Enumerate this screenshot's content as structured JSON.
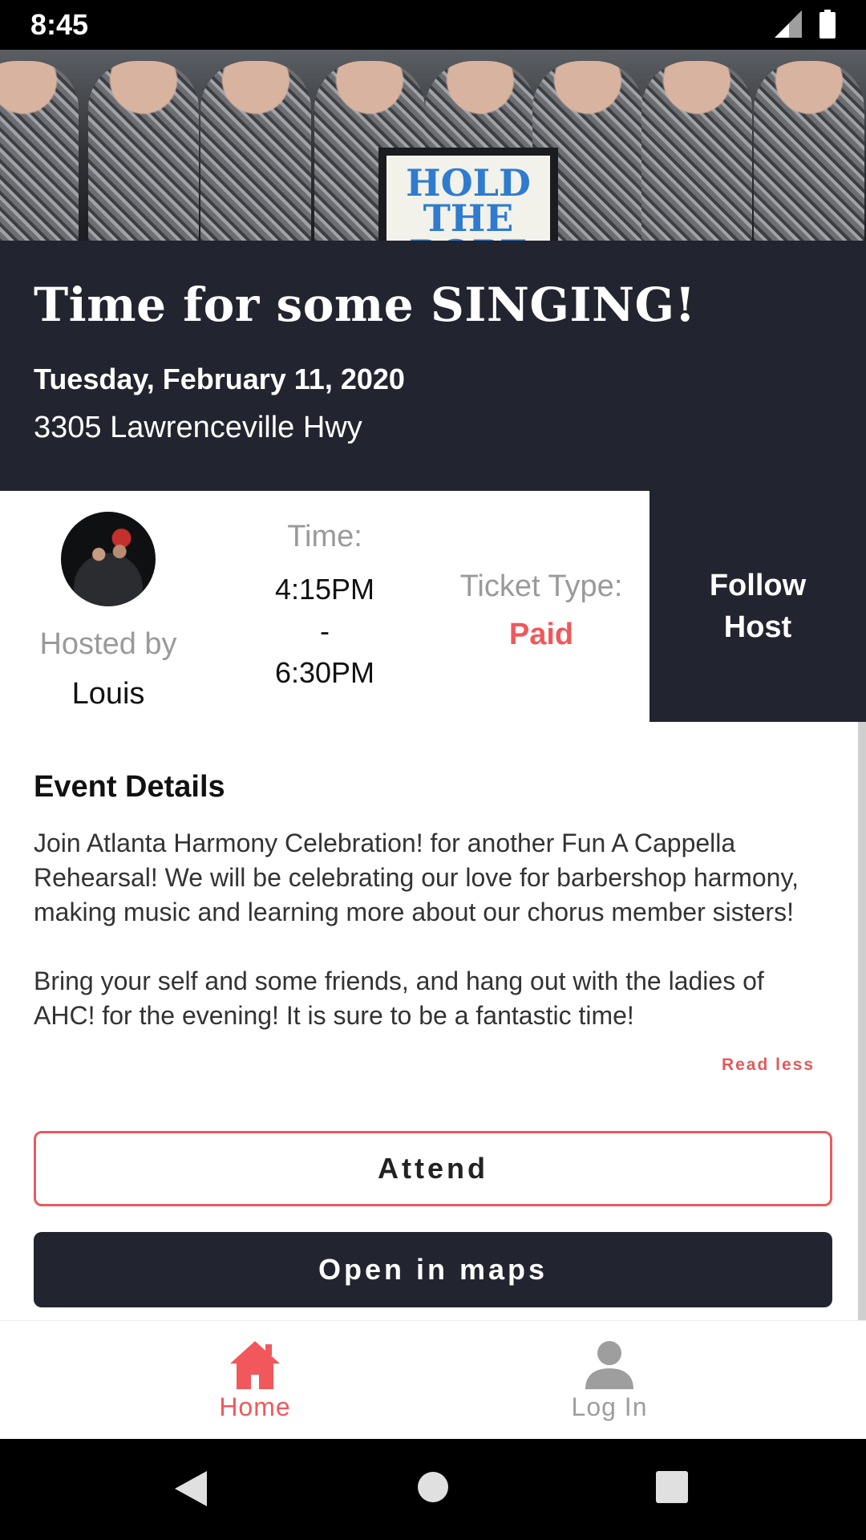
{
  "status_bar": {
    "time": "8:45"
  },
  "hero": {
    "sign_text": "HOLD THE ROPE"
  },
  "event": {
    "title": "Time for some SINGING!",
    "date": "Tuesday, February 11, 2020",
    "address": "3305 Lawrenceville Hwy"
  },
  "info": {
    "hosted_by_label": "Hosted by",
    "host_name": "Louis",
    "time_label": "Time:",
    "time_start": "4:15PM",
    "time_separator": "-",
    "time_end": "6:30PM",
    "ticket_label": "Ticket Type:",
    "ticket_value": "Paid",
    "follow_host_label": "Follow Host"
  },
  "details": {
    "heading": "Event Details",
    "body": "Join Atlanta Harmony Celebration! for another Fun A Cappella Rehearsal! We will be celebrating our love for barbershop harmony, making music and learning more about our chorus member sisters!\n\nBring your self and some friends, and hang out with the ladies of AHC! for the evening! It is sure to be a fantastic time!",
    "read_less": "Read less"
  },
  "actions": {
    "attend_label": "Attend",
    "maps_label": "Open in maps"
  },
  "bottom_nav": {
    "items": [
      {
        "label": "Home",
        "icon": "home-icon",
        "active": true
      },
      {
        "label": "Log In",
        "icon": "person-icon",
        "active": false
      }
    ]
  },
  "colors": {
    "accent": "#f0585c",
    "dark": "#22252f",
    "muted": "#9a9a9a"
  }
}
